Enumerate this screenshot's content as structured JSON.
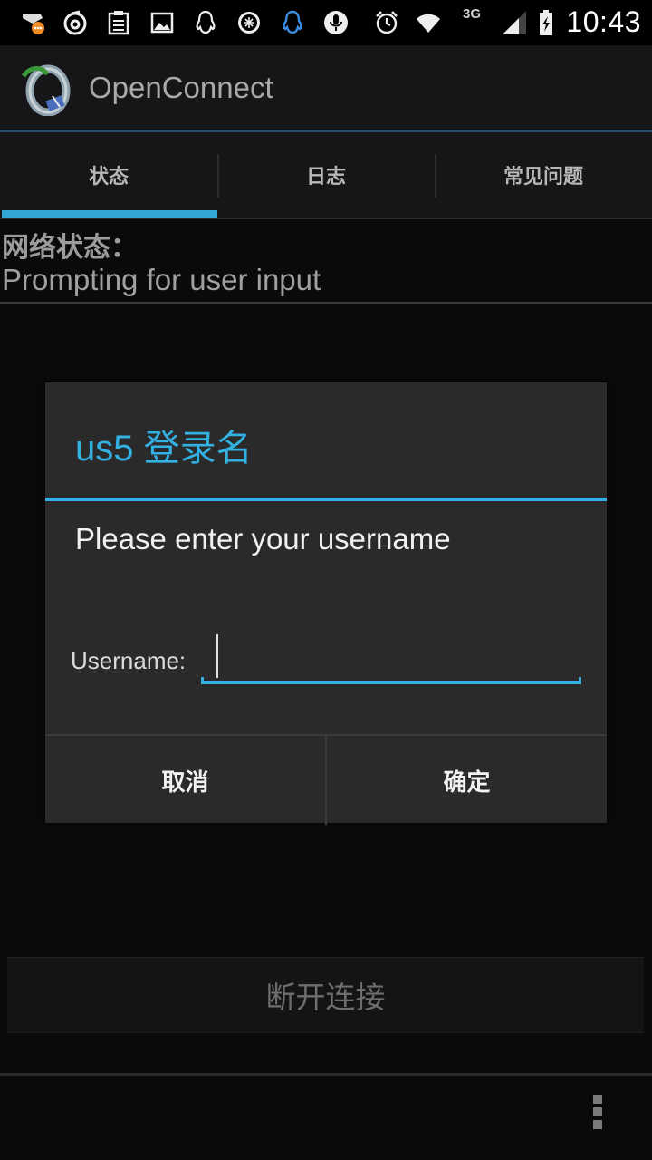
{
  "status_bar": {
    "time": "10:43",
    "network_type": "3G",
    "icons": [
      "chat-notification-icon",
      "netease-music-icon",
      "clipboard-icon",
      "image-icon",
      "qq-icon",
      "compass-icon",
      "qq-blue-icon",
      "microphone-icon",
      "alarm-icon",
      "wifi-icon",
      "signal-icon",
      "battery-charging-icon"
    ]
  },
  "action_bar": {
    "title": "OpenConnect"
  },
  "tabs": [
    {
      "label": "状态",
      "selected": true
    },
    {
      "label": "日志",
      "selected": false
    },
    {
      "label": "常见问题",
      "selected": false
    }
  ],
  "content": {
    "status_label": "网络状态：",
    "status_value": "Prompting for user input",
    "disconnect_label": "断开连接"
  },
  "dialog": {
    "title": "us5 登录名",
    "message": "Please enter your username",
    "field_label": "Username:",
    "field_value": "",
    "cancel_label": "取消",
    "ok_label": "确定"
  },
  "colors": {
    "accent": "#33b1e2",
    "background": "#0a0a0c",
    "dialog_bg": "#2a2a2b"
  }
}
